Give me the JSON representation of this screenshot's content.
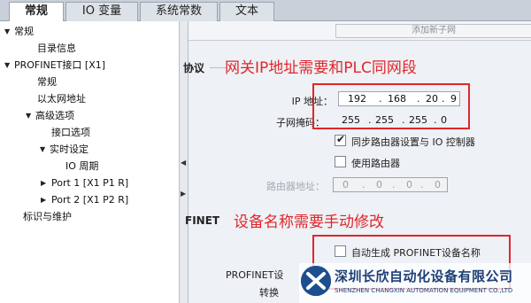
{
  "tabs": [
    {
      "label": "常规",
      "active": true
    },
    {
      "label": "IO 变量",
      "active": false
    },
    {
      "label": "系统常数",
      "active": false
    },
    {
      "label": "文本",
      "active": false
    }
  ],
  "tree": {
    "general": "常规",
    "catalog_info": "目录信息",
    "profinet_interface": "PROFINET接口 [X1]",
    "pn_general": "常规",
    "ethernet_addresses": "以太网地址",
    "advanced_options": "高级选项",
    "interface_options": "接口选项",
    "realtime_settings": "实时设定",
    "io_cycle": "IO 周期",
    "port1": "Port 1 [X1 P1 R]",
    "port2": "Port 2 [X1 P2 R]",
    "identification": "标识与维护"
  },
  "main": {
    "add_subnet_button": "添加新子网",
    "section_protocol": "协议",
    "section_profinet": "FINET",
    "ip_label": "IP 地址：",
    "ip": [
      "192",
      "168",
      "20",
      "9"
    ],
    "mask_label": "子网掩码：",
    "mask": [
      "255",
      "255",
      "255",
      "0"
    ],
    "sync_router_label": "同步路由器设置与 IO 控制器",
    "sync_router_checked": true,
    "use_router_label": "使用路由器",
    "use_router_checked": false,
    "router_address_label": "路由器地址：",
    "router": [
      "0",
      "0",
      "0",
      "0"
    ],
    "auto_gen_label": "自动生成 PROFINET设备名称",
    "auto_gen_checked": false,
    "profinet_device_name_label": "PROFINET设",
    "convert_label": "转换"
  },
  "annotations": {
    "ip_note": "网关IP地址需要和PLC同网段",
    "name_note": "设备名称需要手动修改"
  },
  "watermark": {
    "company_cn": "深圳长欣自动化设备有限公司",
    "company_en": "SHENZHEN CHANGXIN AUTOMATION EQUIPMENT CO.,LTD"
  },
  "colors": {
    "annotation_red": "#e0262b",
    "brand_blue": "#1d4f8f"
  }
}
